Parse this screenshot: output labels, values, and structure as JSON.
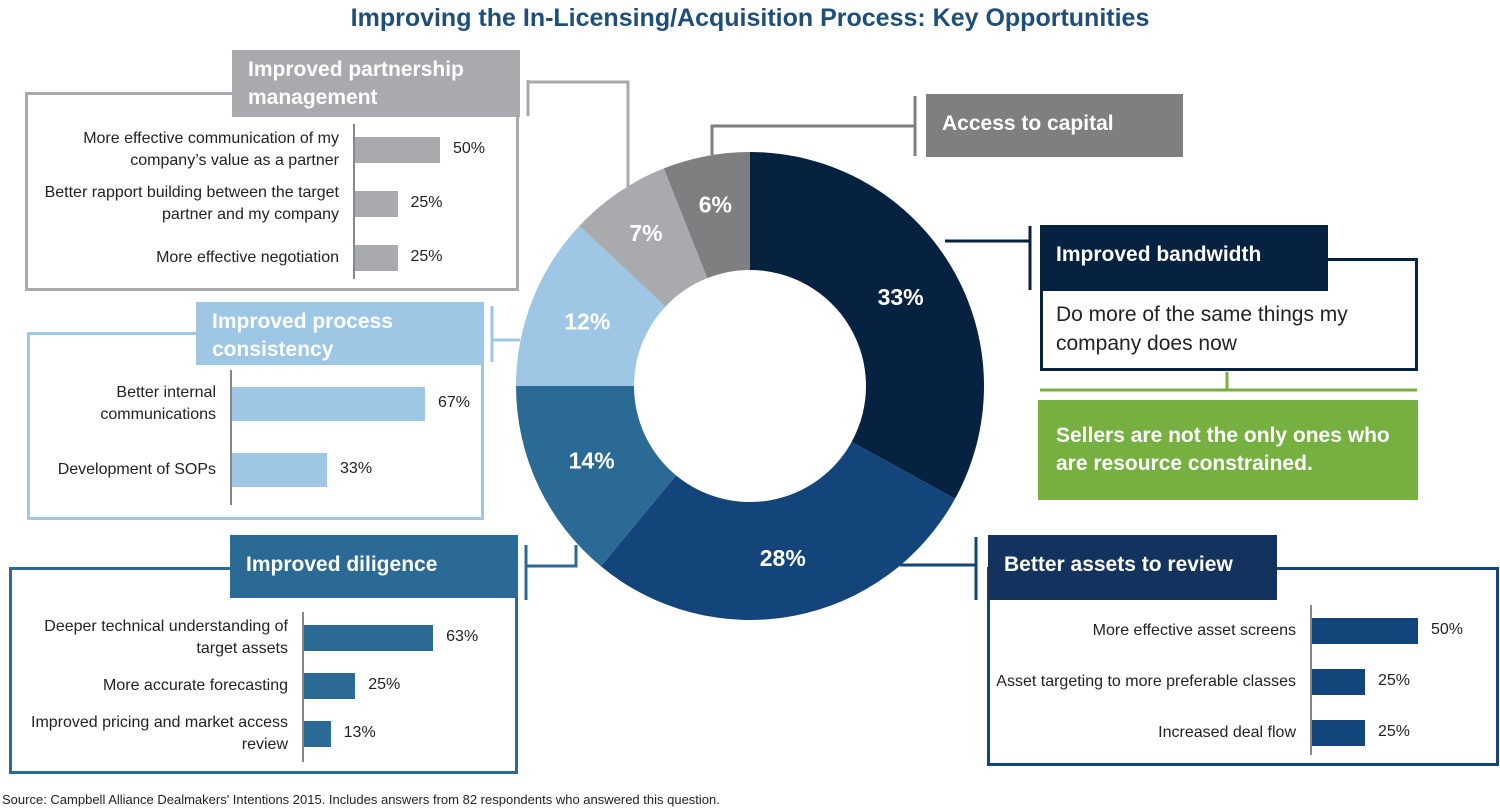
{
  "chart_data": {
    "type": "pie",
    "title": "Improving the In-Licensing/Acquisition Process: Key Opportunities",
    "donut": {
      "categories": [
        "Improved bandwidth",
        "Better assets to review",
        "Improved diligence",
        "Improved process consistency",
        "Improved partnership management",
        "Access to capital"
      ],
      "values": [
        33,
        28,
        14,
        12,
        7,
        6
      ],
      "labels": [
        "33%",
        "28%",
        "14%",
        "12%",
        "7%",
        "6%"
      ],
      "colors": [
        "#062240",
        "#13457a",
        "#2c6a96",
        "#9dc7e4",
        "#a9aaae",
        "#7f7f81"
      ]
    },
    "breakdowns": [
      {
        "id": "partnership",
        "title": "Improved partnership management",
        "type": "bar",
        "color": "#a9aaae",
        "categories": [
          "More effective communication of my company’s value as a partner",
          "Better rapport building between the target partner and my company",
          "More effective negotiation"
        ],
        "values": [
          50,
          25,
          25
        ],
        "labels": [
          "50%",
          "25%",
          "25%"
        ]
      },
      {
        "id": "process",
        "title": "Improved process consistency",
        "type": "bar",
        "color": "#9dc7e4",
        "categories": [
          "Better internal communications",
          "Development of SOPs"
        ],
        "values": [
          67,
          33
        ],
        "labels": [
          "67%",
          "33%"
        ]
      },
      {
        "id": "diligence",
        "title": "Improved diligence",
        "type": "bar",
        "color": "#2c6a96",
        "categories": [
          "Deeper technical understanding of target assets",
          "More accurate forecasting",
          "Improved pricing and market access review"
        ],
        "values": [
          63,
          25,
          13
        ],
        "labels": [
          "63%",
          "25%",
          "13%"
        ]
      },
      {
        "id": "assets",
        "title": "Better assets to review",
        "type": "bar",
        "color": "#13457a",
        "categories": [
          "More effective asset screens",
          "Asset targeting to more preferable classes",
          "Increased deal flow"
        ],
        "values": [
          50,
          25,
          25
        ],
        "labels": [
          "50%",
          "25%",
          "25%"
        ]
      }
    ],
    "access_capital": {
      "title": "Access to capital",
      "color": "#7f7f81"
    },
    "bandwidth": {
      "title": "Improved bandwidth",
      "text": "Do more of the same things my company does now",
      "color": "#062240"
    },
    "callout": {
      "text": "Sellers are not the only ones who are resource constrained.",
      "color": "#76b041"
    },
    "source": "Source: Campbell Alliance Dealmakers' Intentions 2015. Includes answers from 82 respondents who answered this question."
  }
}
